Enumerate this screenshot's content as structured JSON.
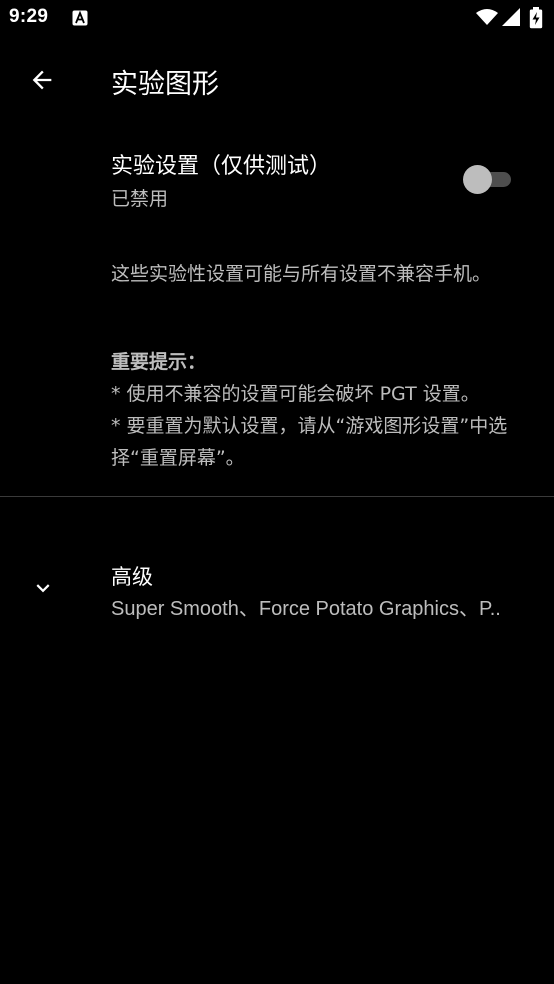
{
  "status_bar": {
    "time": "9:29",
    "icons": [
      "a-notification-icon",
      "wifi-icon",
      "signal-icon",
      "battery-charging-icon"
    ]
  },
  "app_bar": {
    "back_icon": "arrow-back-icon",
    "title": "实验图形"
  },
  "experimental_toggle": {
    "title": "实验设置（仅供测试）",
    "summary": "已禁用",
    "enabled": false
  },
  "description": "这些实验性设置可能与所有设置不兼容手机。",
  "notice": {
    "heading": "重要提示：",
    "lines": [
      "* 使用不兼容的设置可能会破坏 PGT 设置。",
      "* 要重置为默认设置，请从“游戏图形设置”中选择“重置屏幕”。"
    ]
  },
  "advanced": {
    "expand_icon": "chevron-down-icon",
    "title": "高级",
    "summary": "Super Smooth、Force Potato Graphics、P.."
  },
  "colors": {
    "background": "#000000",
    "text_primary": "#ffffff",
    "text_secondary": "#bdbdbd",
    "switch_track_off": "#4e4e4e",
    "switch_thumb_off": "#bdbdbd",
    "divider": "#3a3a3a"
  }
}
